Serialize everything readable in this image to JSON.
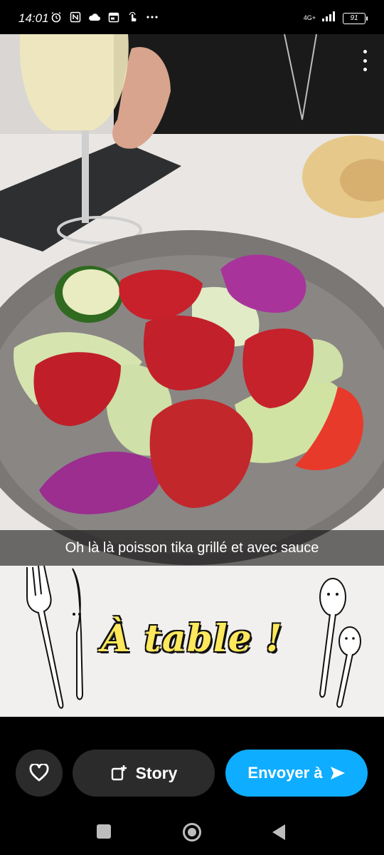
{
  "status_bar": {
    "time": "14:01",
    "network": "4G+",
    "battery": "91",
    "icons": [
      "alarm-icon",
      "nfc-icon",
      "cloud-icon",
      "calendar-icon",
      "gesture-icon",
      "more-dots-icon",
      "signal-icon"
    ]
  },
  "snap": {
    "caption": "Oh là là poisson tika grillé et avec sauce",
    "sticker_text": "À table !",
    "menu_icon": "more-vertical-icon"
  },
  "actions": {
    "favorite_icon": "heart-icon",
    "story_label": "Story",
    "story_icon": "add-story-icon",
    "send_label": "Envoyer à",
    "send_icon": "send-arrow-icon"
  },
  "colors": {
    "send_button": "#0fadff",
    "dark_button": "#2b2b2b",
    "sticker_yellow": "#ffe85c"
  }
}
